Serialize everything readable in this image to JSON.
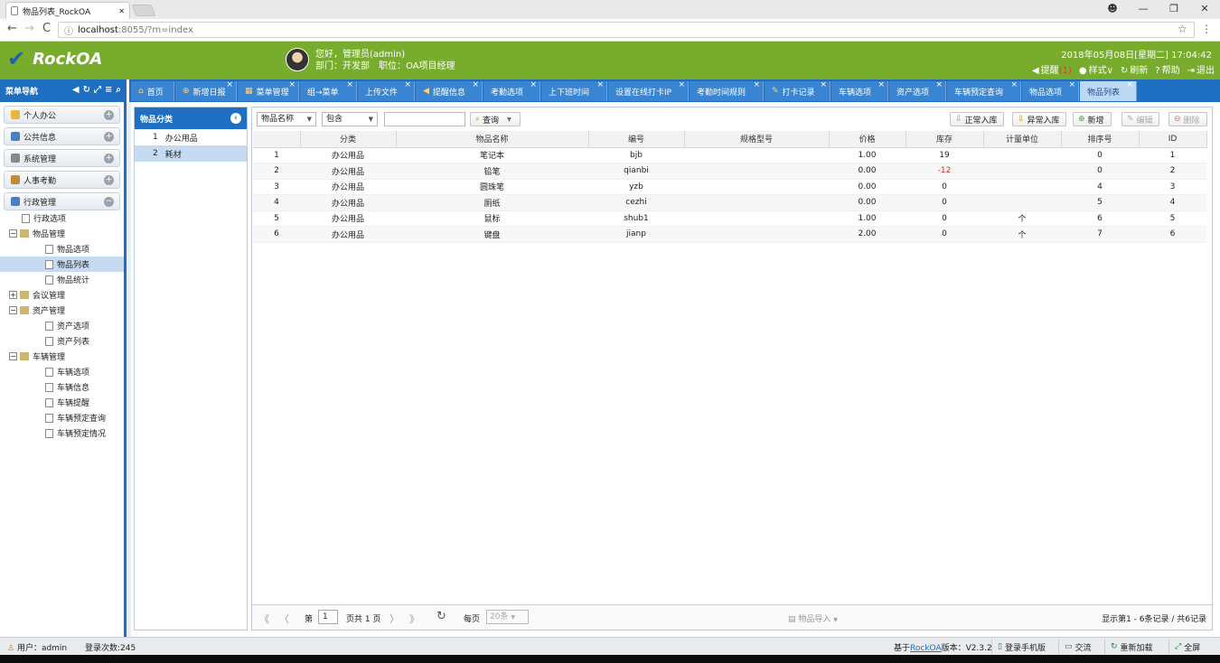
{
  "browser": {
    "tab_title": "物品列表_RockOA",
    "url_host": "localhost",
    "url_rest": ":8055/?m=index",
    "controls": {
      "back": "←",
      "forward": "→",
      "reload": "C",
      "star": "☆",
      "menu": "⋮",
      "info": "ⓘ"
    },
    "window": {
      "account": "☻",
      "min": "—",
      "max": "❐",
      "close": "✕"
    }
  },
  "header": {
    "logo_text": "RockOA",
    "greeting": "您好，管理员(admin)",
    "dept_line": "部门：开发部　职位：OA项目经理",
    "datetime": "2018年05月08日[星期二] 17:04:42",
    "links": [
      {
        "icon": "bell-icon",
        "glyph": "◀",
        "label": "提醒",
        "badge": "(1)"
      },
      {
        "icon": "palette-icon",
        "glyph": "●",
        "label": "样式∨"
      },
      {
        "icon": "refresh-icon",
        "glyph": "↻",
        "label": "刷新"
      },
      {
        "icon": "help-icon",
        "glyph": "?",
        "label": "帮助"
      },
      {
        "icon": "logout-icon",
        "glyph": "⇥",
        "label": "退出"
      }
    ]
  },
  "sidebar": {
    "title": "菜单导航",
    "groups": [
      {
        "label": "个人办公",
        "color": "#e8b63a"
      },
      {
        "label": "公共信息",
        "color": "#4a7fc0"
      },
      {
        "label": "系统管理",
        "color": "#888888"
      },
      {
        "label": "人事考勤",
        "color": "#c08a3a"
      }
    ],
    "open_group": {
      "label": "行政管理",
      "color": "#4a7fc0"
    },
    "tree": [
      {
        "label": "行政选项",
        "level": 1,
        "kind": "doc"
      },
      {
        "label": "物品管理",
        "level": 0,
        "kind": "folder",
        "toggle": "−"
      },
      {
        "label": "物品选项",
        "level": 2,
        "kind": "doc"
      },
      {
        "label": "物品列表",
        "level": 2,
        "kind": "doc",
        "selected": true
      },
      {
        "label": "物品统计",
        "level": 2,
        "kind": "doc"
      },
      {
        "label": "会议管理",
        "level": 0,
        "kind": "folder",
        "toggle": "+"
      },
      {
        "label": "资产管理",
        "level": 0,
        "kind": "folder",
        "toggle": "−"
      },
      {
        "label": "资产选项",
        "level": 2,
        "kind": "doc"
      },
      {
        "label": "资产列表",
        "level": 2,
        "kind": "doc"
      },
      {
        "label": "车辆管理",
        "level": 0,
        "kind": "folder",
        "toggle": "−"
      },
      {
        "label": "车辆选项",
        "level": 2,
        "kind": "doc"
      },
      {
        "label": "车辆信息",
        "level": 2,
        "kind": "doc"
      },
      {
        "label": "车辆提醒",
        "level": 2,
        "kind": "doc"
      },
      {
        "label": "车辆预定查询",
        "level": 2,
        "kind": "doc"
      },
      {
        "label": "车辆预定情况",
        "level": 2,
        "kind": "doc"
      }
    ]
  },
  "tabs": [
    {
      "label": "首页",
      "icon": "⌂",
      "closable": false
    },
    {
      "label": "新增日报",
      "icon": "⊕",
      "closable": true
    },
    {
      "label": "菜单管理",
      "icon": "▦",
      "closable": true
    },
    {
      "label": "组→菜单",
      "icon": "",
      "closable": true
    },
    {
      "label": "上传文件",
      "icon": "",
      "closable": true
    },
    {
      "label": "提醒信息",
      "icon": "◀",
      "closable": true
    },
    {
      "label": "考勤选项",
      "icon": "",
      "closable": true
    },
    {
      "label": "上下班时间",
      "icon": "",
      "closable": true
    },
    {
      "label": "设置在线打卡IP",
      "icon": "",
      "closable": true
    },
    {
      "label": "考勤时间规则",
      "icon": "",
      "closable": true
    },
    {
      "label": "打卡记录",
      "icon": "✎",
      "closable": true
    },
    {
      "label": "车辆选项",
      "icon": "",
      "closable": true
    },
    {
      "label": "资产选项",
      "icon": "",
      "closable": true
    },
    {
      "label": "车辆预定查询",
      "icon": "",
      "closable": true
    },
    {
      "label": "物品选项",
      "icon": "",
      "closable": true
    },
    {
      "label": "物品列表",
      "icon": "",
      "closable": true,
      "active": true
    }
  ],
  "tab_close_glyph": "×",
  "category": {
    "title": "物品分类",
    "back_glyph": "‹",
    "items": [
      {
        "num": "1",
        "label": "办公用品",
        "selected": false
      },
      {
        "num": "2",
        "label": "耗材",
        "selected": true
      }
    ]
  },
  "toolbar": {
    "field_select": "物品名称",
    "op_select": "包含",
    "search_value": "",
    "search_label": "查询",
    "arrow": "▼",
    "buttons": [
      {
        "label": "正常入库",
        "disabled": false
      },
      {
        "label": "异常入库",
        "disabled": false
      },
      {
        "label": "新增",
        "disabled": false
      },
      {
        "label": "编辑",
        "disabled": true
      },
      {
        "label": "删除",
        "disabled": true
      }
    ]
  },
  "grid": {
    "headers": [
      "",
      "分类",
      "物品名称",
      "编号",
      "规格型号",
      "价格",
      "库存",
      "计量单位",
      "排序号",
      "ID"
    ],
    "rows": [
      [
        "1",
        "办公用品",
        "笔记本",
        "bjb",
        "",
        "1.00",
        "19",
        "",
        "0",
        "1"
      ],
      [
        "2",
        "办公用品",
        "铅笔",
        "qianbi",
        "",
        "0.00",
        "-12",
        "",
        "0",
        "2"
      ],
      [
        "3",
        "办公用品",
        "圆珠笔",
        "yzb",
        "",
        "0.00",
        "0",
        "",
        "4",
        "3"
      ],
      [
        "4",
        "办公用品",
        "厕纸",
        "cezhi",
        "",
        "0.00",
        "0",
        "",
        "5",
        "4"
      ],
      [
        "5",
        "办公用品",
        "鼠标",
        "shub1",
        "",
        "1.00",
        "0",
        "个",
        "6",
        "5"
      ],
      [
        "6",
        "办公用品",
        "键盘",
        "jianp",
        "",
        "2.00",
        "0",
        "个",
        "7",
        "6"
      ]
    ],
    "negative_color": "#e22222"
  },
  "pager": {
    "first": "《",
    "prev": "〈",
    "next": "〉",
    "last": "》",
    "refresh": "↻",
    "page_prefix": "第",
    "page_value": "1",
    "page_suffix": "页共 1 页",
    "per_page_label": "每页",
    "per_page_value": "20条",
    "import_label": "物品导入",
    "info": "显示第1 - 6条记录 / 共6记录"
  },
  "footer": {
    "user": "用户：admin",
    "login_count": "登录次数:245",
    "version_prefix": "基于",
    "version_link": "RockOA",
    "version_suffix": "版本：V2.3.2",
    "buttons": [
      "登录手机版",
      "交流",
      "重新加载",
      "全屏"
    ]
  },
  "colors": {
    "brand_green": "#78ac2c",
    "primary_blue": "#1e6fc1",
    "tab_blue": "#3a85d1",
    "active_tab": "#bcd8f5",
    "selection": "#c6dbf1"
  }
}
